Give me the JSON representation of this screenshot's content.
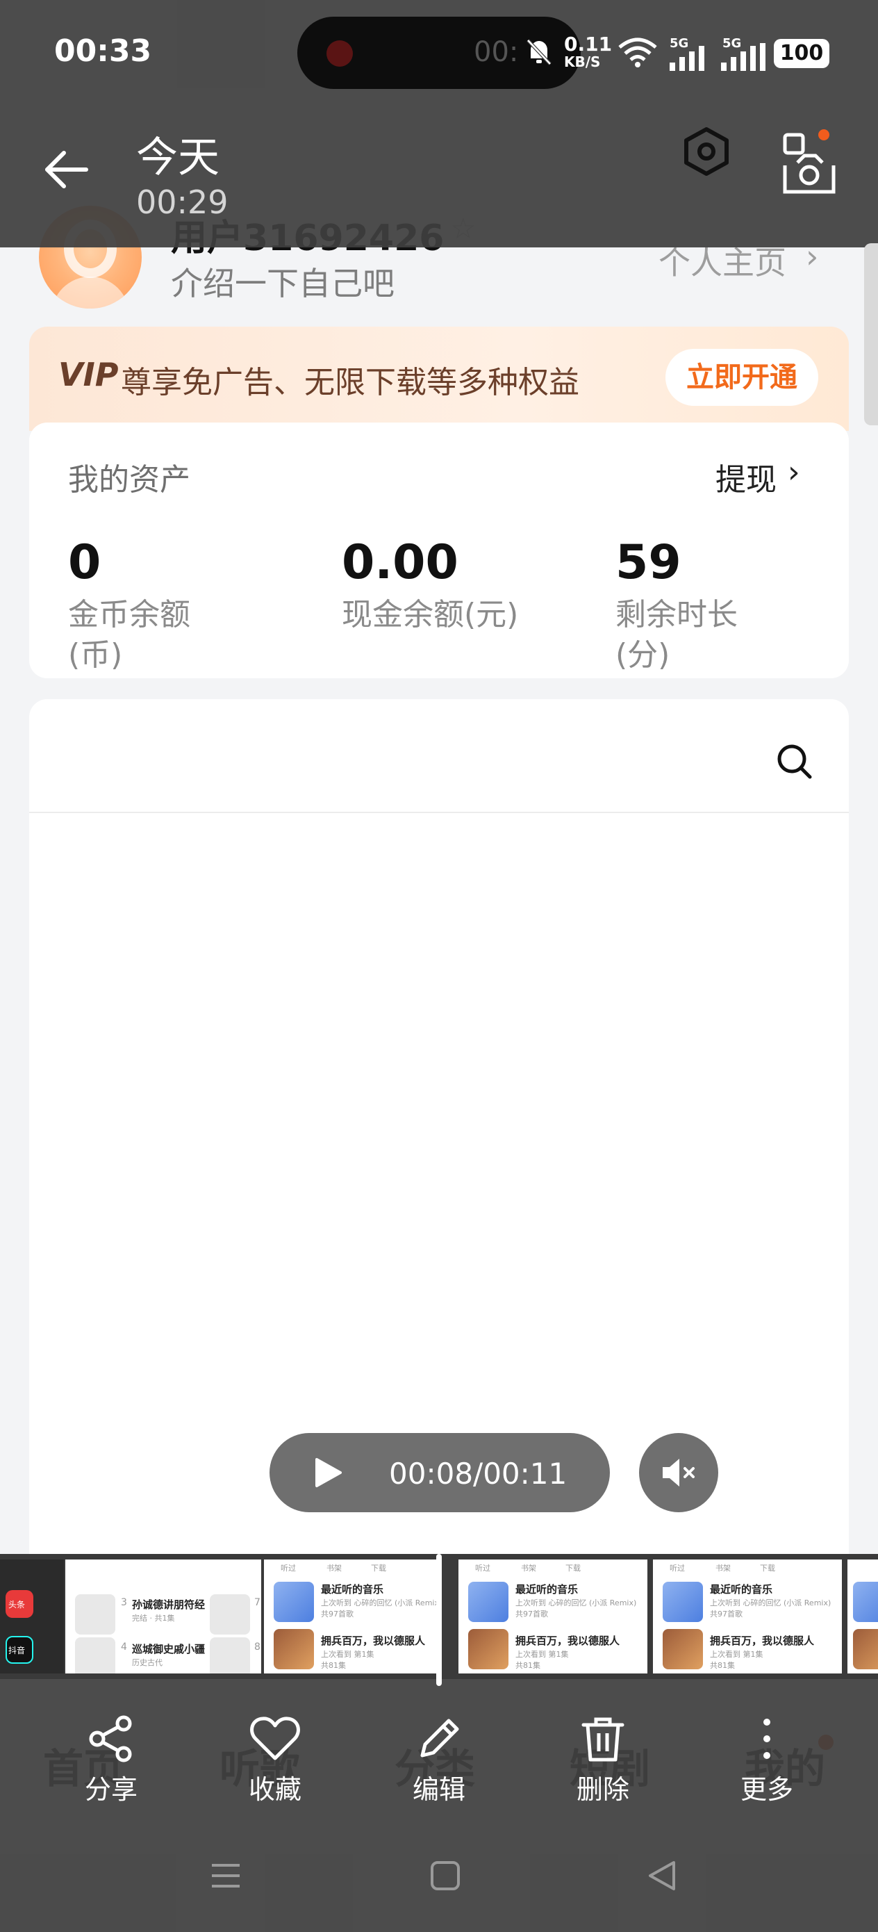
{
  "status_bar": {
    "time": "00:33",
    "island_time": "00:",
    "net_speed_value": "0.11",
    "net_speed_unit": "KB/S",
    "signal1": "5G",
    "signal2": "5G",
    "battery": "100"
  },
  "header": {
    "title": "今天",
    "subtitle": "00:29"
  },
  "profile": {
    "name": "用户31692426",
    "intro": "介绍一下自己吧",
    "homepage_link": "个人主页",
    "chevron": "›"
  },
  "vip": {
    "mark": "VIP",
    "text": "尊享免广告、无限下载等多种权益",
    "button": "立即开通"
  },
  "assets": {
    "title": "我的资产",
    "withdraw": "提现",
    "chevron": "›",
    "items": [
      {
        "value": "0",
        "label_line1": "金币余额",
        "label_line2": "(币)"
      },
      {
        "value": "0.00",
        "label_line1": "现金余额(元)",
        "label_line2": ""
      },
      {
        "value": "59",
        "label_line1": "剩余时长",
        "label_line2": "(分)"
      }
    ]
  },
  "bottom_nav": {
    "items": [
      "首页",
      "听歌",
      "分类",
      "短剧",
      "我的"
    ]
  },
  "playback": {
    "time": "00:08/00:11"
  },
  "filmstrip": {
    "tabs": [
      "听过",
      "书架",
      "下载"
    ],
    "rows": [
      {
        "title": "最近听的音乐",
        "sub": "上次听到 心碎的回忆 (小派 Remix)",
        "count": "共97首歌"
      },
      {
        "title": "拥兵百万，我以德服人",
        "sub": "上次看到 第1集",
        "count": "共81集"
      }
    ],
    "left_rows": [
      {
        "num": "3",
        "title": "孙诚德讲朋符经",
        "sub": "完结 · 共1集"
      },
      {
        "num": "4",
        "title": "巡城御史戚小疆",
        "sub": "历史古代"
      }
    ],
    "left_nums": [
      "7",
      "8"
    ],
    "app_labels": [
      "头条",
      "抖音"
    ]
  },
  "actions": [
    {
      "label": "分享",
      "icon": "share-icon"
    },
    {
      "label": "收藏",
      "icon": "heart-icon"
    },
    {
      "label": "编辑",
      "icon": "pencil-icon"
    },
    {
      "label": "删除",
      "icon": "trash-icon"
    },
    {
      "label": "更多",
      "icon": "more-vertical-icon"
    }
  ],
  "colors": {
    "accent": "#f26a1b",
    "overlay": "#3c3c3c",
    "vip_text": "#6b3f2a"
  }
}
